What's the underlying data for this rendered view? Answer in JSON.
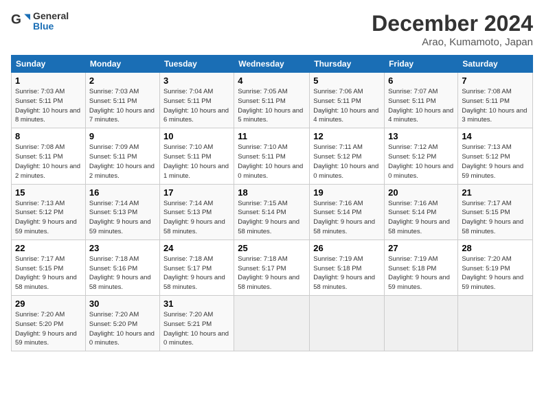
{
  "logo": {
    "line1": "General",
    "line2": "Blue"
  },
  "title": "December 2024",
  "location": "Arao, Kumamoto, Japan",
  "days_of_week": [
    "Sunday",
    "Monday",
    "Tuesday",
    "Wednesday",
    "Thursday",
    "Friday",
    "Saturday"
  ],
  "weeks": [
    [
      {
        "day": "1",
        "sunrise": "7:03 AM",
        "sunset": "5:11 PM",
        "daylight": "10 hours and 8 minutes."
      },
      {
        "day": "2",
        "sunrise": "7:03 AM",
        "sunset": "5:11 PM",
        "daylight": "10 hours and 7 minutes."
      },
      {
        "day": "3",
        "sunrise": "7:04 AM",
        "sunset": "5:11 PM",
        "daylight": "10 hours and 6 minutes."
      },
      {
        "day": "4",
        "sunrise": "7:05 AM",
        "sunset": "5:11 PM",
        "daylight": "10 hours and 5 minutes."
      },
      {
        "day": "5",
        "sunrise": "7:06 AM",
        "sunset": "5:11 PM",
        "daylight": "10 hours and 4 minutes."
      },
      {
        "day": "6",
        "sunrise": "7:07 AM",
        "sunset": "5:11 PM",
        "daylight": "10 hours and 4 minutes."
      },
      {
        "day": "7",
        "sunrise": "7:08 AM",
        "sunset": "5:11 PM",
        "daylight": "10 hours and 3 minutes."
      }
    ],
    [
      {
        "day": "8",
        "sunrise": "7:08 AM",
        "sunset": "5:11 PM",
        "daylight": "10 hours and 2 minutes."
      },
      {
        "day": "9",
        "sunrise": "7:09 AM",
        "sunset": "5:11 PM",
        "daylight": "10 hours and 2 minutes."
      },
      {
        "day": "10",
        "sunrise": "7:10 AM",
        "sunset": "5:11 PM",
        "daylight": "10 hours and 1 minute."
      },
      {
        "day": "11",
        "sunrise": "7:10 AM",
        "sunset": "5:11 PM",
        "daylight": "10 hours and 0 minutes."
      },
      {
        "day": "12",
        "sunrise": "7:11 AM",
        "sunset": "5:12 PM",
        "daylight": "10 hours and 0 minutes."
      },
      {
        "day": "13",
        "sunrise": "7:12 AM",
        "sunset": "5:12 PM",
        "daylight": "10 hours and 0 minutes."
      },
      {
        "day": "14",
        "sunrise": "7:13 AM",
        "sunset": "5:12 PM",
        "daylight": "9 hours and 59 minutes."
      }
    ],
    [
      {
        "day": "15",
        "sunrise": "7:13 AM",
        "sunset": "5:12 PM",
        "daylight": "9 hours and 59 minutes."
      },
      {
        "day": "16",
        "sunrise": "7:14 AM",
        "sunset": "5:13 PM",
        "daylight": "9 hours and 59 minutes."
      },
      {
        "day": "17",
        "sunrise": "7:14 AM",
        "sunset": "5:13 PM",
        "daylight": "9 hours and 58 minutes."
      },
      {
        "day": "18",
        "sunrise": "7:15 AM",
        "sunset": "5:14 PM",
        "daylight": "9 hours and 58 minutes."
      },
      {
        "day": "19",
        "sunrise": "7:16 AM",
        "sunset": "5:14 PM",
        "daylight": "9 hours and 58 minutes."
      },
      {
        "day": "20",
        "sunrise": "7:16 AM",
        "sunset": "5:14 PM",
        "daylight": "9 hours and 58 minutes."
      },
      {
        "day": "21",
        "sunrise": "7:17 AM",
        "sunset": "5:15 PM",
        "daylight": "9 hours and 58 minutes."
      }
    ],
    [
      {
        "day": "22",
        "sunrise": "7:17 AM",
        "sunset": "5:15 PM",
        "daylight": "9 hours and 58 minutes."
      },
      {
        "day": "23",
        "sunrise": "7:18 AM",
        "sunset": "5:16 PM",
        "daylight": "9 hours and 58 minutes."
      },
      {
        "day": "24",
        "sunrise": "7:18 AM",
        "sunset": "5:17 PM",
        "daylight": "9 hours and 58 minutes."
      },
      {
        "day": "25",
        "sunrise": "7:18 AM",
        "sunset": "5:17 PM",
        "daylight": "9 hours and 58 minutes."
      },
      {
        "day": "26",
        "sunrise": "7:19 AM",
        "sunset": "5:18 PM",
        "daylight": "9 hours and 58 minutes."
      },
      {
        "day": "27",
        "sunrise": "7:19 AM",
        "sunset": "5:18 PM",
        "daylight": "9 hours and 59 minutes."
      },
      {
        "day": "28",
        "sunrise": "7:20 AM",
        "sunset": "5:19 PM",
        "daylight": "9 hours and 59 minutes."
      }
    ],
    [
      {
        "day": "29",
        "sunrise": "7:20 AM",
        "sunset": "5:20 PM",
        "daylight": "9 hours and 59 minutes."
      },
      {
        "day": "30",
        "sunrise": "7:20 AM",
        "sunset": "5:20 PM",
        "daylight": "10 hours and 0 minutes."
      },
      {
        "day": "31",
        "sunrise": "7:20 AM",
        "sunset": "5:21 PM",
        "daylight": "10 hours and 0 minutes."
      },
      null,
      null,
      null,
      null
    ]
  ]
}
